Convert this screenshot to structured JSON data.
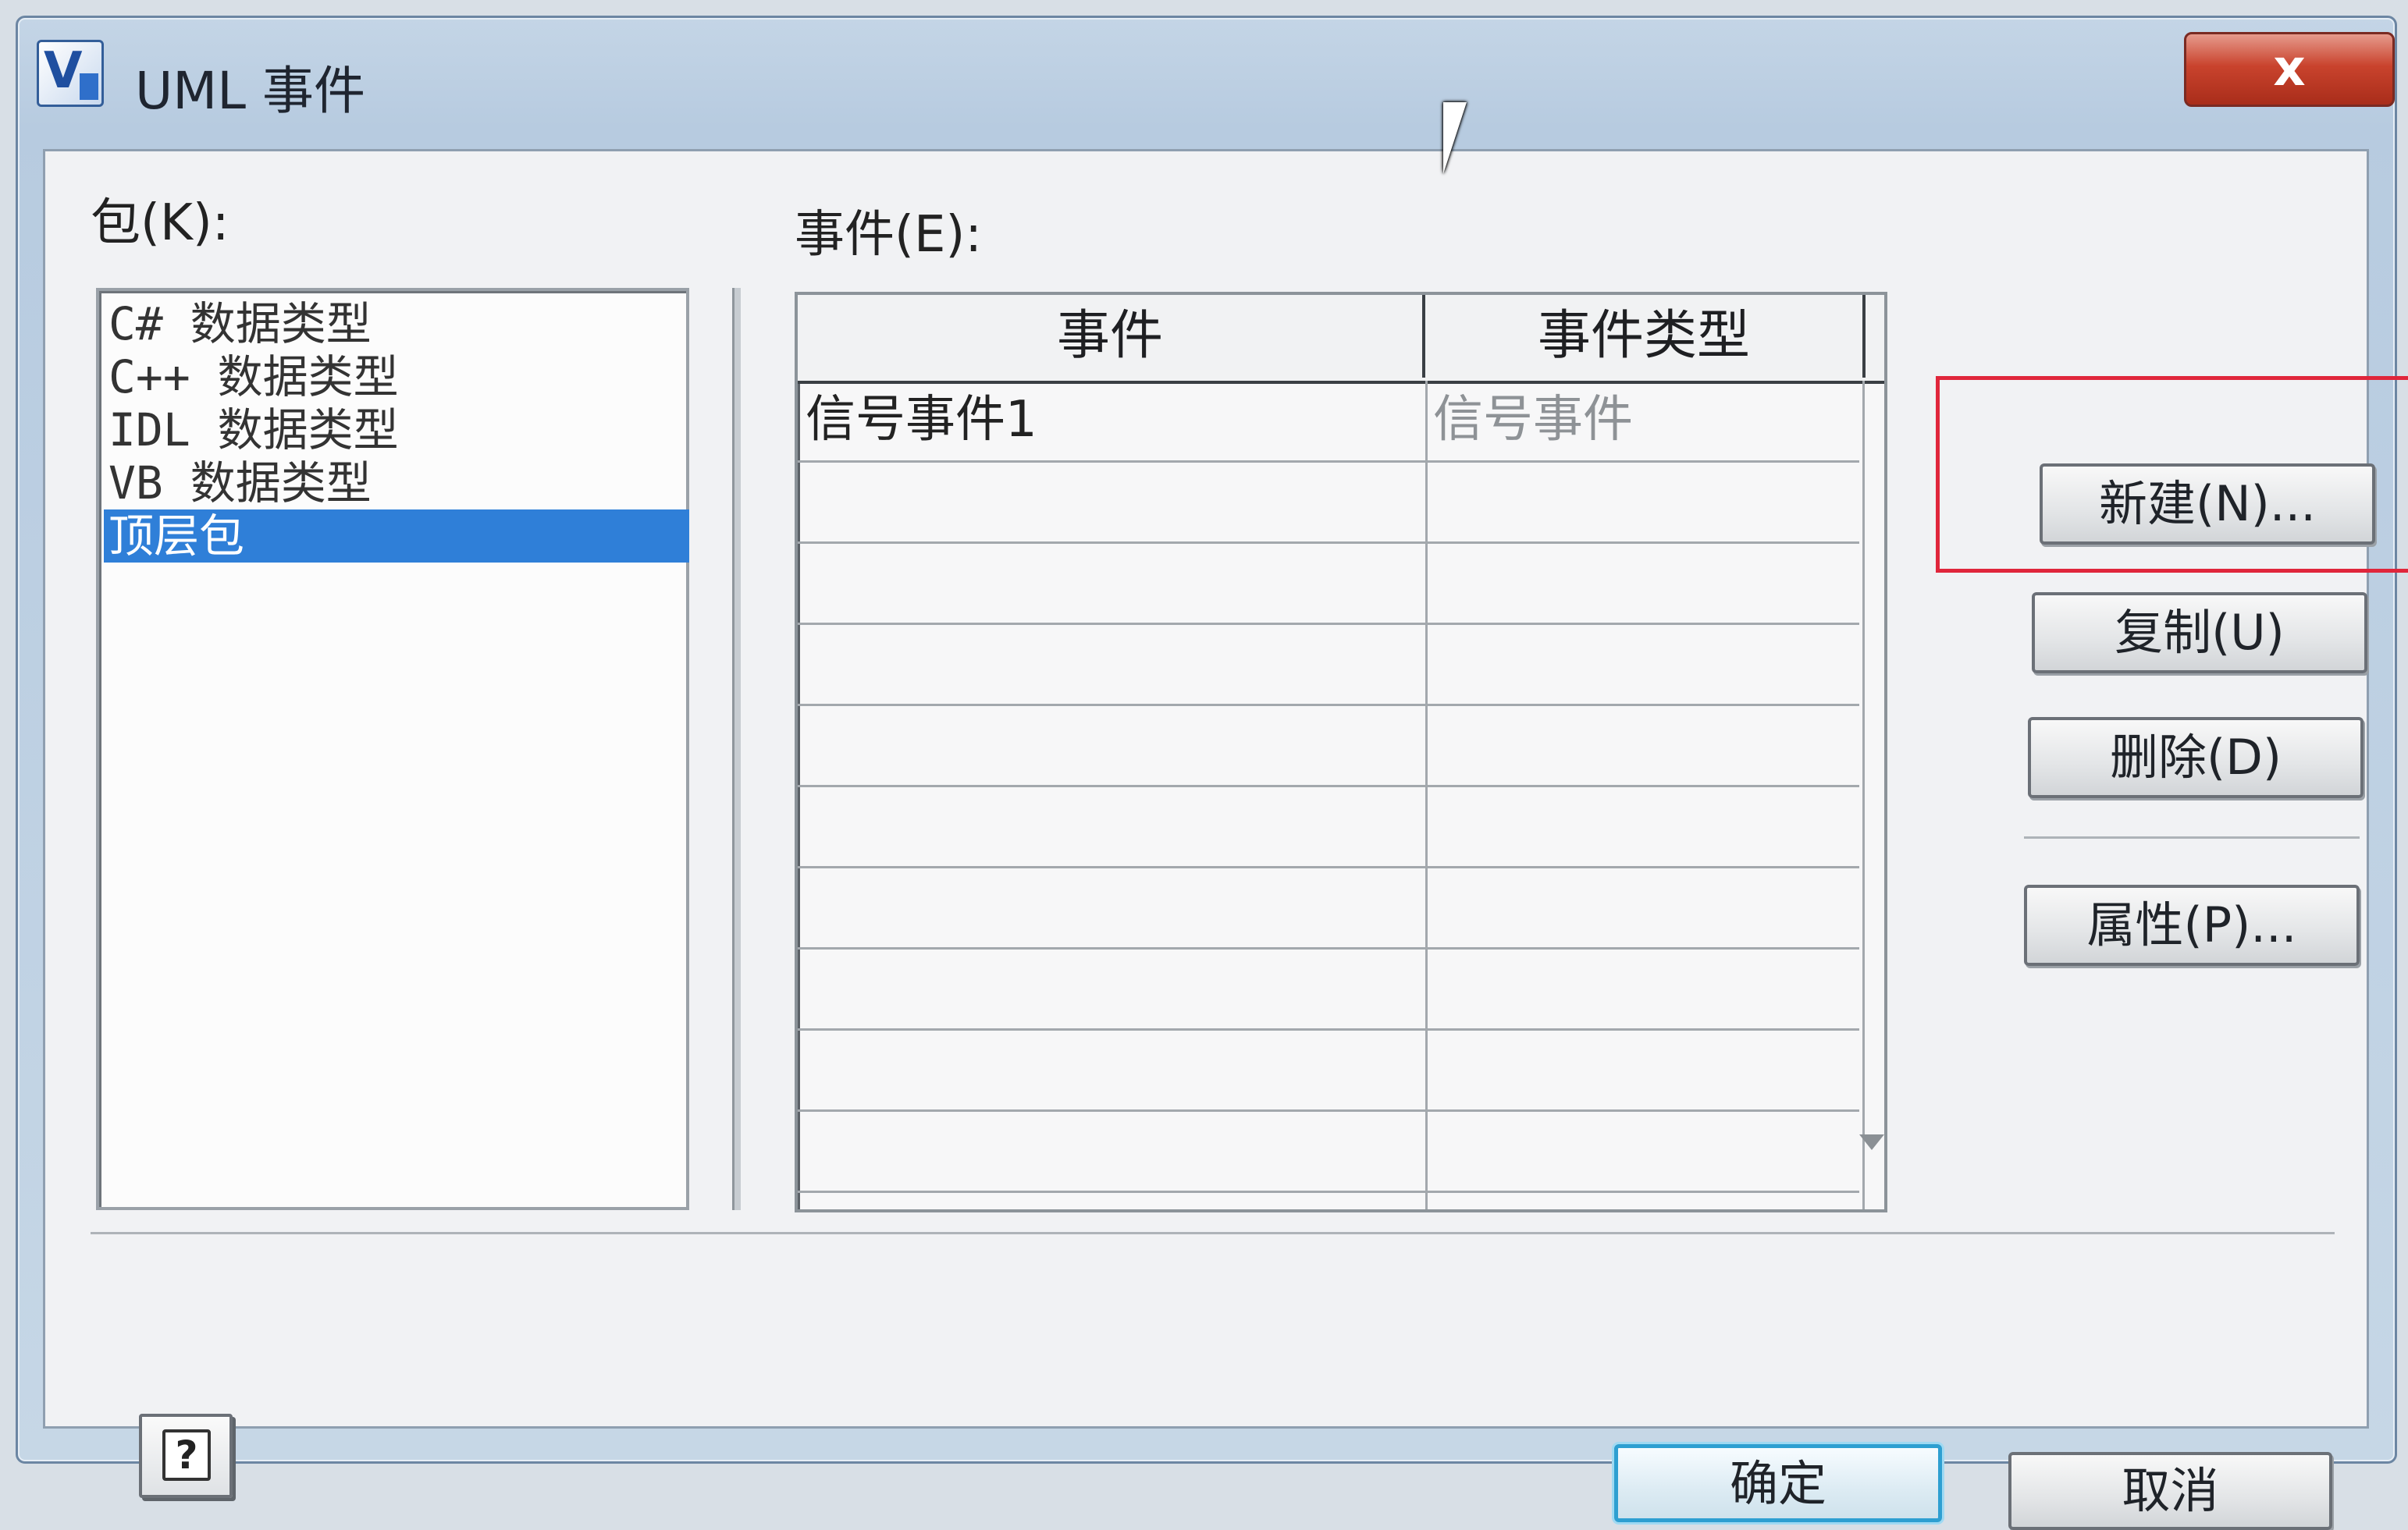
{
  "window": {
    "title": "UML 事件",
    "icon_name": "visio-app-icon",
    "close_label": "x"
  },
  "packages": {
    "label": "包(K):",
    "items": [
      {
        "label": "C# 数据类型",
        "selected": false
      },
      {
        "label": "C++ 数据类型",
        "selected": false
      },
      {
        "label": "IDL 数据类型",
        "selected": false
      },
      {
        "label": "VB 数据类型",
        "selected": false
      },
      {
        "label": "顶层包",
        "selected": true
      }
    ]
  },
  "events": {
    "label": "事件(E):",
    "columns": [
      "事件",
      "事件类型"
    ],
    "rows": [
      {
        "name": "信号事件1",
        "type": "信号事件"
      }
    ],
    "empty_rows": 9
  },
  "actions": {
    "new": "新建(N)...",
    "copy": "复制(U)",
    "delete": "删除(D)",
    "properties": "属性(P)..."
  },
  "footer": {
    "ok": "确定",
    "cancel": "取消",
    "help_icon": "?"
  },
  "colors": {
    "selection": "#2f7fd8",
    "highlight_box": "#e0263b",
    "close_button": "#c9432d"
  }
}
